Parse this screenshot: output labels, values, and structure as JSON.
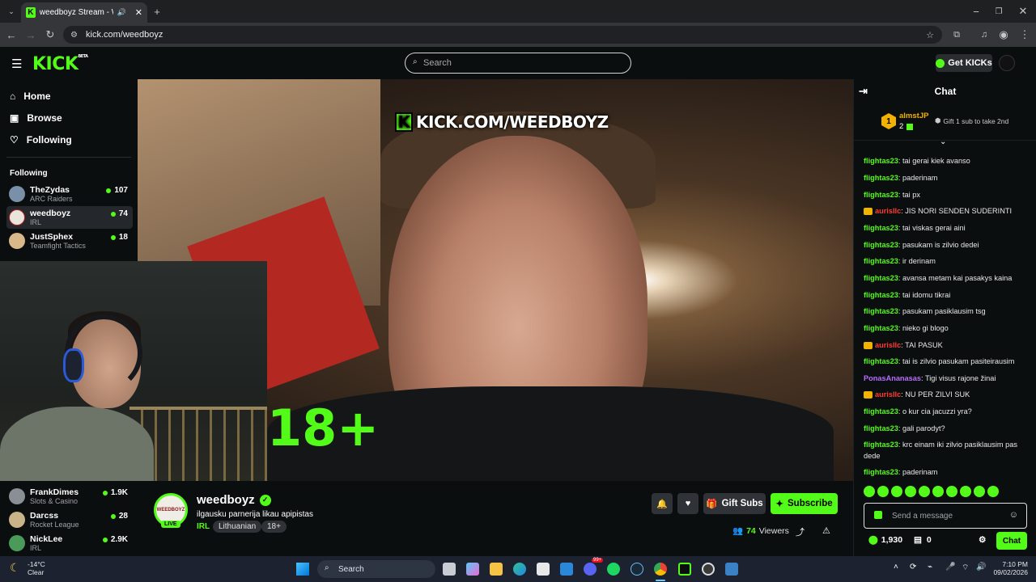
{
  "browser": {
    "tab_title": "weedboyz Stream - Watch l",
    "url": "kick.com/weedboyz"
  },
  "header": {
    "logo": "KICK",
    "logo_sup": "BETA",
    "search_placeholder": "Search",
    "get_kicks": "Get KICKs"
  },
  "sidebar": {
    "nav": [
      {
        "label": "Home",
        "icon": "home-icon"
      },
      {
        "label": "Browse",
        "icon": "browse-icon"
      },
      {
        "label": "Following",
        "icon": "heart-icon"
      }
    ],
    "following_heading": "Following",
    "following": [
      {
        "name": "TheZydas",
        "category": "ARC Raiders",
        "viewers": "107",
        "color": "#7a8fa8"
      },
      {
        "name": "weedboyz",
        "category": "IRL",
        "viewers": "74",
        "color": "#e9e4dc"
      },
      {
        "name": "JustSphex",
        "category": "Teamfight Tactics",
        "viewers": "18",
        "color": "#d9b88a"
      }
    ],
    "bottom": [
      {
        "name": "FrankDimes",
        "category": "Slots & Casino",
        "viewers": "1.9K",
        "color": "#8a8f96"
      },
      {
        "name": "Darcss",
        "category": "Rocket League",
        "viewers": "28",
        "color": "#c9b48a"
      },
      {
        "name": "NickLee",
        "category": "IRL",
        "viewers": "2.9K",
        "color": "#4a9a5a"
      }
    ]
  },
  "video": {
    "overlay_text": "KICK.COM/WEEDBOYZ",
    "overlay_k": "K",
    "age_badge": "18+"
  },
  "stream": {
    "channel": "weedboyz",
    "avatar_text": "WEEDBOYZ",
    "live": "LIVE",
    "title": "ilgausku parnerija likau apipistas",
    "category": "IRL",
    "tags": [
      "Lithuanian",
      "18+"
    ],
    "gift_subs": "Gift Subs",
    "subscribe": "Subscribe",
    "viewers_count": "74",
    "viewers_label": "Viewers"
  },
  "chat": {
    "title": "Chat",
    "pinned_user": "almstJP",
    "pinned_rank": "1",
    "pinned_count": "2",
    "pinned_note": "Gift 1 sub to take 2nd",
    "messages": [
      {
        "user": "flightas23",
        "text": "tai gerai kiek avanso",
        "color": "#53fc18",
        "badge": false
      },
      {
        "user": "flightas23",
        "text": "paderinam",
        "color": "#53fc18",
        "badge": false
      },
      {
        "user": "flightas23",
        "text": "tai px",
        "color": "#53fc18",
        "badge": false
      },
      {
        "user": "aurisllc",
        "text": "JIS NORI SENDEN SUDERINTI",
        "color": "#ff3b30",
        "badge": true
      },
      {
        "user": "flightas23",
        "text": "tai viskas gerai aini",
        "color": "#53fc18",
        "badge": false
      },
      {
        "user": "flightas23",
        "text": "pasukam is zilvio dedei",
        "color": "#53fc18",
        "badge": false
      },
      {
        "user": "flightas23",
        "text": "ir derinam",
        "color": "#53fc18",
        "badge": false
      },
      {
        "user": "flightas23",
        "text": "avansa metam kai pasakys kaina",
        "color": "#53fc18",
        "badge": false
      },
      {
        "user": "flightas23",
        "text": "tai idomu tikrai",
        "color": "#53fc18",
        "badge": false
      },
      {
        "user": "flightas23",
        "text": "pasukam pasiklausim tsg",
        "color": "#53fc18",
        "badge": false
      },
      {
        "user": "flightas23",
        "text": "nieko gi blogo",
        "color": "#53fc18",
        "badge": false
      },
      {
        "user": "aurisllc",
        "text": "TAI PASUK",
        "color": "#ff3b30",
        "badge": true
      },
      {
        "user": "flightas23",
        "text": "tai is zilvio pasukam pasiteirausim",
        "color": "#53fc18",
        "badge": false
      },
      {
        "user": "PonasAnanasas",
        "text": "Tigi visus rajone žinai",
        "color": "#b66dff",
        "badge": false
      },
      {
        "user": "aurisllc",
        "text": "NU PER ZILVI SUK",
        "color": "#ff3b30",
        "badge": true
      },
      {
        "user": "flightas23",
        "text": "o kur cia jacuzzi yra?",
        "color": "#53fc18",
        "badge": false
      },
      {
        "user": "flightas23",
        "text": "gali parodyt?",
        "color": "#53fc18",
        "badge": false
      },
      {
        "user": "flightas23",
        "text": "krc einam iki zilvio pasiklausim pas dede",
        "color": "#53fc18",
        "badge": false
      },
      {
        "user": "flightas23",
        "text": "paderinam",
        "color": "#53fc18",
        "badge": false
      }
    ],
    "input_placeholder": "Send a message",
    "points": "1,930",
    "rewards": "0",
    "send_label": "Chat"
  },
  "taskbar": {
    "weather_temp": "-14°C",
    "weather_desc": "Clear",
    "search_label": "Search",
    "time": "7:10 PM",
    "date": "09/02/2026",
    "badge": "99+"
  },
  "colors": {
    "accent": "#53fc18",
    "bg": "#0b0e0f"
  }
}
